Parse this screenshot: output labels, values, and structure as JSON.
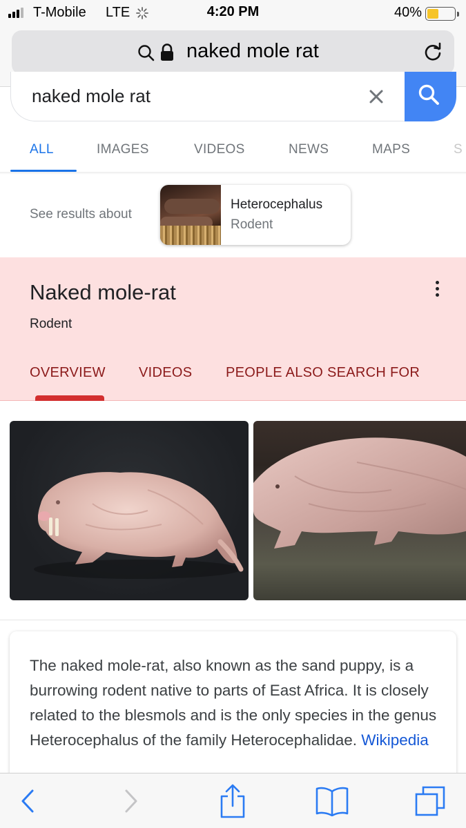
{
  "status_bar": {
    "carrier": "T-Mobile",
    "network": "LTE",
    "time": "4:20 PM",
    "battery_percent": "40%",
    "battery_level": 0.4,
    "signal_bars_filled": 3
  },
  "browser": {
    "url_text": "naked mole rat"
  },
  "search": {
    "query": "naked mole rat"
  },
  "tabs": [
    {
      "label": "ALL",
      "active": true
    },
    {
      "label": "IMAGES",
      "active": false
    },
    {
      "label": "VIDEOS",
      "active": false
    },
    {
      "label": "NEWS",
      "active": false
    },
    {
      "label": "MAPS",
      "active": false
    },
    {
      "label": "S",
      "active": false
    }
  ],
  "see_results": {
    "label": "See results about",
    "entity_name": "Heterocephalus",
    "entity_type": "Rodent"
  },
  "knowledge_panel": {
    "title": "Naked mole-rat",
    "subtitle": "Rodent",
    "tabs": [
      "OVERVIEW",
      "VIDEOS",
      "PEOPLE ALSO SEARCH FOR"
    ],
    "active_tab": "OVERVIEW",
    "accent_color": "#d32f2f",
    "background_color": "#fde0e0"
  },
  "description": {
    "text": "The naked mole-rat, also known as the sand puppy, is a burrowing rodent native to parts of East Africa. It is closely related to the blesmols and is the only species in the genus Heterocephalus of the family Heterocephalidae. ",
    "source_link": "Wikipedia"
  },
  "toolbar": {
    "buttons": [
      "back-icon",
      "forward-icon",
      "share-icon",
      "bookmarks-icon",
      "tabs-icon"
    ]
  },
  "colors": {
    "google_blue": "#4285f4",
    "active_tab": "#1a73e8",
    "safari_blue": "#2b7bf3"
  }
}
